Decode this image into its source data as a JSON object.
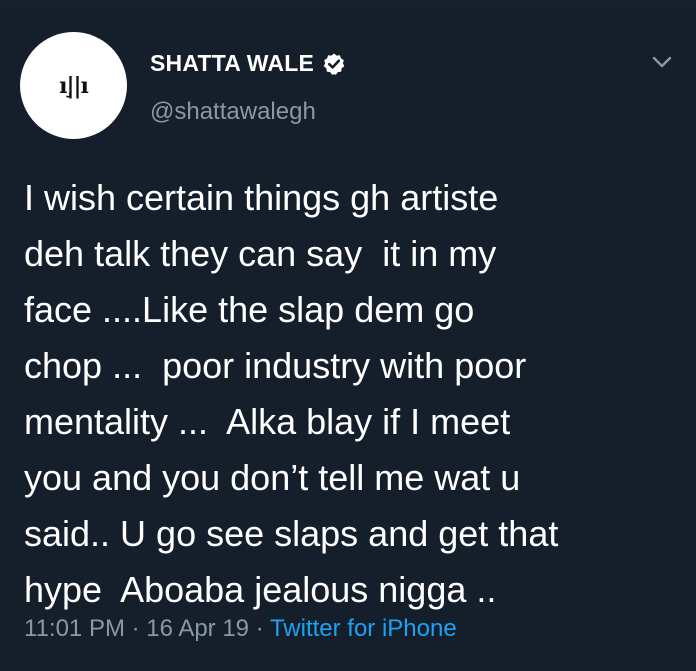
{
  "user": {
    "avatar_mark": "ı|̧|ı",
    "display_name": "SHATTA WALE",
    "handle": "@shattawalegh",
    "verified": true
  },
  "tweet": {
    "lines": [
      "I wish certain things gh artiste",
      "deh talk they can say  it in my",
      "face ....Like the slap dem go",
      "chop ...  poor industry with poor",
      "mentality ...  Alka blay if I meet",
      "you and you don’t tell me wat u",
      "said.. U go see slaps and get that",
      "hype  Aboaba jealous nigga .."
    ],
    "time": "11:01 PM",
    "separator": " · ",
    "date": "16 Apr 19",
    "source": "Twitter for iPhone"
  },
  "colors": {
    "background": "#151f2c",
    "text": "#ffffff",
    "muted": "#8899a6",
    "accent": "#1da1f2"
  },
  "icons": {
    "verified": "verified-badge-icon",
    "menu": "chevron-down-icon"
  }
}
